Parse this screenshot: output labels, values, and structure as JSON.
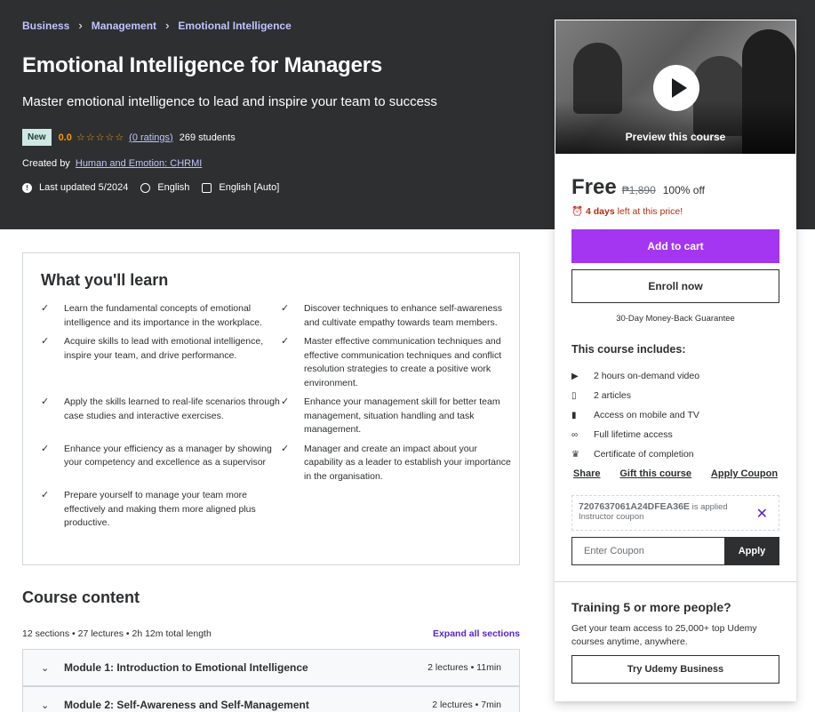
{
  "breadcrumb": [
    "Business",
    "Management",
    "Emotional Intelligence"
  ],
  "course": {
    "title": "Emotional Intelligence for Managers",
    "subtitle": "Master emotional intelligence to lead and inspire your team to success",
    "badge": "New",
    "rating": "0.0",
    "stars": "☆☆☆☆☆",
    "ratings_link": "(0 ratings)",
    "students": "269 students",
    "created_by_label": "Created by",
    "instructor": "Human and Emotion: CHRMI",
    "last_updated": "Last updated 5/2024",
    "language": "English",
    "captions": "English [Auto]"
  },
  "learn": {
    "title": "What you'll learn",
    "items": [
      "Learn the fundamental concepts of emotional intelligence and its importance in the workplace.",
      "Discover techniques to enhance self-awareness and cultivate empathy towards team members.",
      "Acquire skills to lead with emotional intelligence, inspire your team, and drive performance.",
      "Master effective communication techniques and effective communication techniques and conflict resolution strategies to create a positive work environment.",
      "Apply the skills learned to real-life scenarios through case studies and interactive exercises.",
      "Enhance your management skill for better team management, situation handling and task management.",
      "Enhance your efficiency as a manager by showing your competency and excellence as a supervisor",
      "Manager and create an impact about your capability as a leader to establish your importance in the organisation.",
      "Prepare yourself to manage your team more effectively and making them more aligned plus productive."
    ]
  },
  "content": {
    "title": "Course content",
    "stats": "12 sections • 27 lectures • 2h 12m total length",
    "expand_all": "Expand all sections",
    "modules": [
      {
        "name": "Module 1: Introduction to Emotional Intelligence",
        "stats": "2 lectures • 11min"
      },
      {
        "name": "Module 2: Self-Awareness and Self-Management",
        "stats": "2 lectures • 7min"
      }
    ]
  },
  "sidebar": {
    "preview_label": "Preview this course",
    "price": "Free",
    "original_price": "₱1,890",
    "discount": "100% off",
    "timer_bold": "4 days",
    "timer_rest": " left at this price!",
    "add_to_cart": "Add to cart",
    "enroll_now": "Enroll now",
    "guarantee": "30-Day Money-Back Guarantee",
    "includes_title": "This course includes:",
    "includes": [
      {
        "icon": "video-icon",
        "glyph": "▶",
        "text": "2 hours on-demand video"
      },
      {
        "icon": "file-icon",
        "glyph": "▯",
        "text": "2 articles"
      },
      {
        "icon": "mobile-icon",
        "glyph": "▮",
        "text": "Access on mobile and TV"
      },
      {
        "icon": "infinity-icon",
        "glyph": "∞",
        "text": "Full lifetime access"
      },
      {
        "icon": "trophy-icon",
        "glyph": "♛",
        "text": "Certificate of completion"
      }
    ],
    "share": "Share",
    "gift": "Gift this course",
    "apply_coupon": "Apply Coupon",
    "coupon_code": "7207637061A24DFEA36E",
    "coupon_applied": " is applied",
    "coupon_type": "Instructor coupon",
    "coupon_placeholder": "Enter Coupon",
    "apply": "Apply",
    "biz_title": "Training 5 or more people?",
    "biz_text": "Get your team access to 25,000+ top Udemy courses anytime, anywhere.",
    "biz_button": "Try Udemy Business"
  }
}
